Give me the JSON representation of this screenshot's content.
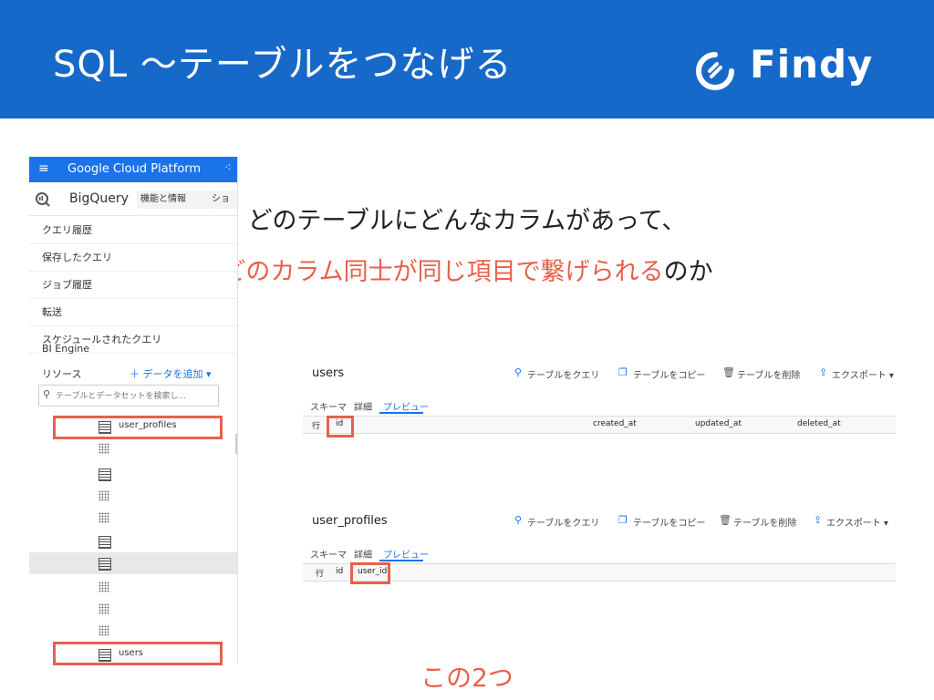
{
  "slide": {
    "title": "SQL 〜テーブルをつなげる",
    "logo_text": "Findy",
    "headline_line1": "どのテーブルにどんなカラムがあって、",
    "headline_line2_red": "どのカラム同士が同じ項目で繋げられる",
    "headline_line2_dark": "のか",
    "bottom_label": "この2つ",
    "colors": {
      "header_bg": "#1769c9",
      "accent_red": "#e8604c",
      "gcp_blue": "#1a73e8"
    }
  },
  "gcp": {
    "menu_icon": "≡",
    "brand": "Google Cloud Platform",
    "bigquery_label": "BigQuery",
    "chip1": "機能と情報",
    "chip2": "ショ",
    "nav": [
      "クエリ履歴",
      "保存したクエリ",
      "ジョブ履歴",
      "転送",
      "スケジュールされたクエリ",
      "BI Engine"
    ],
    "resources_label": "リソース",
    "add_data_label": "＋ データを追加 ▾",
    "search_placeholder": "テーブルとデータセットを検索し...",
    "tree_items": {
      "user_profiles": "user_profiles",
      "users": "users"
    }
  },
  "users_panel": {
    "title": "users",
    "actions": [
      "テーブルをクエリ",
      "テーブルをコピー",
      "テーブルを削除",
      "エクスポート ▾"
    ],
    "tabs": [
      "スキーマ",
      "詳細",
      "プレビュー"
    ],
    "columns": [
      "行",
      "id",
      "created_at",
      "updated_at",
      "deleted_at"
    ]
  },
  "profiles_panel": {
    "title": "user_profiles",
    "actions": [
      "テーブルをクエリ",
      "テーブルをコピー",
      "テーブルを削除",
      "エクスポート ▾"
    ],
    "tabs": [
      "スキーマ",
      "詳細",
      "プレビュー"
    ],
    "columns": [
      "行",
      "id",
      "user_id"
    ]
  }
}
